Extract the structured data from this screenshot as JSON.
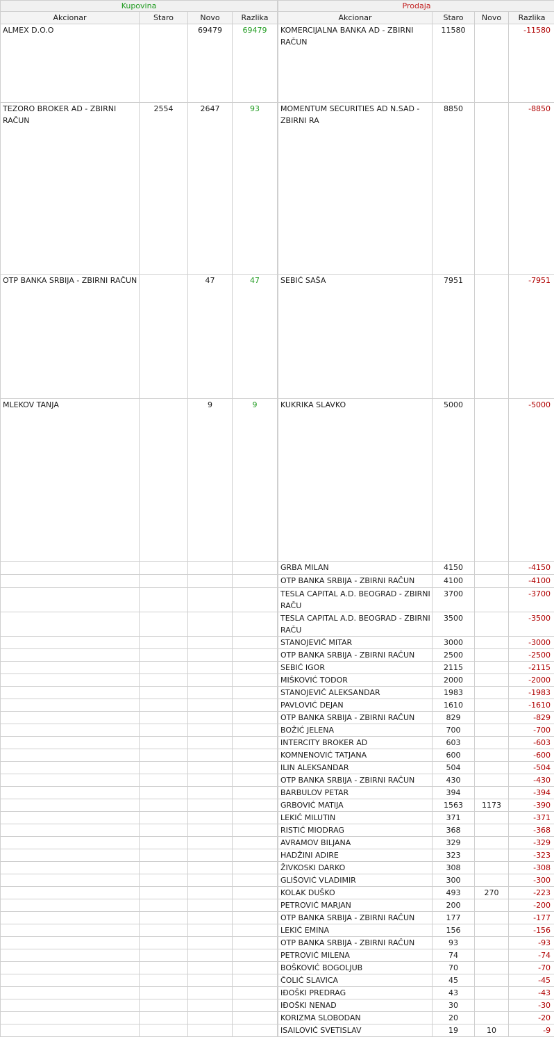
{
  "buy": {
    "title": "Kupovina",
    "headers": {
      "name": "Akcionar",
      "old": "Staro",
      "new": "Novo",
      "diff": "Razlika"
    },
    "rows": [
      {
        "name": "ALMEX D.O.O",
        "old": "",
        "new": "69479",
        "diff": "69479"
      },
      {
        "name": "TEZORO BROKER AD - ZBIRNI RAČUN",
        "old": "2554",
        "new": "2647",
        "diff": "93"
      },
      {
        "name": "OTP BANKA SRBIJA - ZBIRNI RAČUN",
        "old": "",
        "new": "47",
        "diff": "47"
      },
      {
        "name": "MLEKOV TANJA",
        "old": "",
        "new": "9",
        "diff": "9"
      }
    ]
  },
  "sell": {
    "title": "Prodaja",
    "headers": {
      "name": "Akcionar",
      "old": "Staro",
      "new": "Novo",
      "diff": "Razlika"
    },
    "rows": [
      {
        "name": "KOMERCIJALNA BANKA AD - ZBIRNI RAČUN",
        "old": "11580",
        "new": "",
        "diff": "-11580"
      },
      {
        "name": "MOMENTUM SECURITIES AD N.SAD - ZBIRNI RA",
        "old": "8850",
        "new": "",
        "diff": "-8850"
      },
      {
        "name": "SEBIĆ SAŠA",
        "old": "7951",
        "new": "",
        "diff": "-7951"
      },
      {
        "name": "KUKRIKA SLAVKO",
        "old": "5000",
        "new": "",
        "diff": "-5000"
      },
      {
        "name": "GRBA MILAN",
        "old": "4150",
        "new": "",
        "diff": "-4150"
      },
      {
        "name": "OTP BANKA SRBIJA - ZBIRNI RAČUN",
        "old": "4100",
        "new": "",
        "diff": "-4100"
      },
      {
        "name": "TESLA CAPITAL A.D. BEOGRAD - ZBIRNI RAČU",
        "old": "3700",
        "new": "",
        "diff": "-3700"
      },
      {
        "name": "TESLA CAPITAL A.D. BEOGRAD - ZBIRNI RAČU",
        "old": "3500",
        "new": "",
        "diff": "-3500"
      },
      {
        "name": "STANOJEVIĆ MITAR",
        "old": "3000",
        "new": "",
        "diff": "-3000"
      },
      {
        "name": "OTP BANKA SRBIJA - ZBIRNI RAČUN",
        "old": "2500",
        "new": "",
        "diff": "-2500"
      },
      {
        "name": "SEBIĆ IGOR",
        "old": "2115",
        "new": "",
        "diff": "-2115"
      },
      {
        "name": "MIŠKOVIĆ TODOR",
        "old": "2000",
        "new": "",
        "diff": "-2000"
      },
      {
        "name": "STANOJEVIĆ ALEKSANDAR",
        "old": "1983",
        "new": "",
        "diff": "-1983"
      },
      {
        "name": "PAVLOVIĆ DEJAN",
        "old": "1610",
        "new": "",
        "diff": "-1610"
      },
      {
        "name": "OTP BANKA SRBIJA - ZBIRNI RAČUN",
        "old": "829",
        "new": "",
        "diff": "-829"
      },
      {
        "name": "BOŽIĆ JELENA",
        "old": "700",
        "new": "",
        "diff": "-700"
      },
      {
        "name": "INTERCITY BROKER AD",
        "old": "603",
        "new": "",
        "diff": "-603"
      },
      {
        "name": "KOMNENOVIĆ TATJANA",
        "old": "600",
        "new": "",
        "diff": "-600"
      },
      {
        "name": "ILIN ALEKSANDAR",
        "old": "504",
        "new": "",
        "diff": "-504"
      },
      {
        "name": "OTP BANKA SRBIJA - ZBIRNI RAČUN",
        "old": "430",
        "new": "",
        "diff": "-430"
      },
      {
        "name": "BARBULOV PETAR",
        "old": "394",
        "new": "",
        "diff": "-394"
      },
      {
        "name": "GRBOVIĆ MATIJA",
        "old": "1563",
        "new": "1173",
        "diff": "-390"
      },
      {
        "name": "LEKIĆ MILUTIN",
        "old": "371",
        "new": "",
        "diff": "-371"
      },
      {
        "name": "RISTIĆ MIODRAG",
        "old": "368",
        "new": "",
        "diff": "-368"
      },
      {
        "name": "AVRAMOV BILJANA",
        "old": "329",
        "new": "",
        "diff": "-329"
      },
      {
        "name": "HADŽINI ADIRE",
        "old": "323",
        "new": "",
        "diff": "-323"
      },
      {
        "name": "ŽIVKOSKI DARKO",
        "old": "308",
        "new": "",
        "diff": "-308"
      },
      {
        "name": "GLIŠOVIĆ VLADIMIR",
        "old": "300",
        "new": "",
        "diff": "-300"
      },
      {
        "name": "KOLAK DUŠKO",
        "old": "493",
        "new": "270",
        "diff": "-223"
      },
      {
        "name": "PETROVIĆ MARJAN",
        "old": "200",
        "new": "",
        "diff": "-200"
      },
      {
        "name": "OTP BANKA SRBIJA - ZBIRNI RAČUN",
        "old": "177",
        "new": "",
        "diff": "-177"
      },
      {
        "name": "LEKIĆ EMINA",
        "old": "156",
        "new": "",
        "diff": "-156"
      },
      {
        "name": "OTP BANKA SRBIJA - ZBIRNI RAČUN",
        "old": "93",
        "new": "",
        "diff": "-93"
      },
      {
        "name": "PETROVIĆ MILENA",
        "old": "74",
        "new": "",
        "diff": "-74"
      },
      {
        "name": "BOŠKOVIĆ BOGOLJUB",
        "old": "70",
        "new": "",
        "diff": "-70"
      },
      {
        "name": "ČOLIĆ SLAVICA",
        "old": "45",
        "new": "",
        "diff": "-45"
      },
      {
        "name": "IĐOŠKI PREDRAG",
        "old": "43",
        "new": "",
        "diff": "-43"
      },
      {
        "name": "IĐOŠKI NENAD",
        "old": "30",
        "new": "",
        "diff": "-30"
      },
      {
        "name": "KORIZMA SLOBODAN",
        "old": "20",
        "new": "",
        "diff": "-20"
      },
      {
        "name": "ISAILOVIĆ SVETISLAV",
        "old": "19",
        "new": "10",
        "diff": "-9"
      }
    ]
  }
}
